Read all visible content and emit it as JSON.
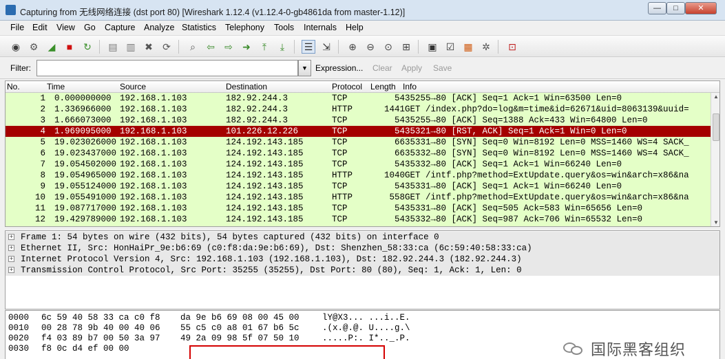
{
  "window": {
    "title": "Capturing from 无线网络连接 (dst port 80)   [Wireshark 1.12.4  (v1.12.4-0-gb4861da from master-1.12)]",
    "min_icon": "minimize-icon",
    "max_icon": "maximize-icon",
    "close_icon": "close-icon",
    "min_glyph": "—",
    "max_glyph": "□",
    "close_glyph": "✕"
  },
  "menu": [
    {
      "label": "File"
    },
    {
      "label": "Edit"
    },
    {
      "label": "View"
    },
    {
      "label": "Go"
    },
    {
      "label": "Capture"
    },
    {
      "label": "Analyze"
    },
    {
      "label": "Statistics"
    },
    {
      "label": "Telephony"
    },
    {
      "label": "Tools"
    },
    {
      "label": "Internals"
    },
    {
      "label": "Help"
    }
  ],
  "toolbar": [
    {
      "icon": "interfaces-icon",
      "glyph": "◉",
      "color": "#3c3c3c"
    },
    {
      "icon": "options-icon",
      "glyph": "⚙",
      "color": "#555555"
    },
    {
      "icon": "start-capture-icon",
      "glyph": "◢",
      "color": "#3a8f2a"
    },
    {
      "icon": "stop-capture-icon",
      "glyph": "■",
      "color": "#d01010"
    },
    {
      "icon": "restart-capture-icon",
      "glyph": "↻",
      "color": "#3a8f2a"
    },
    {
      "icon": "open-file-icon",
      "glyph": "▤",
      "color": "#7a7a7a"
    },
    {
      "icon": "save-file-icon",
      "glyph": "▥",
      "color": "#7a7a7a"
    },
    {
      "icon": "close-file-icon",
      "glyph": "✖",
      "color": "#555555"
    },
    {
      "icon": "reload-icon",
      "glyph": "⟳",
      "color": "#555555"
    },
    {
      "icon": "find-packet-icon",
      "glyph": "⌕",
      "color": "#555555"
    },
    {
      "icon": "go-back-icon",
      "glyph": "⇦",
      "color": "#3c8c2c"
    },
    {
      "icon": "go-forward-icon",
      "glyph": "⇨",
      "color": "#3c8c2c"
    },
    {
      "icon": "go-to-packet-icon",
      "glyph": "➜",
      "color": "#3c8c2c"
    },
    {
      "icon": "go-first-icon",
      "glyph": "⤒",
      "color": "#3c8c2c"
    },
    {
      "icon": "go-last-icon",
      "glyph": "⤓",
      "color": "#3c8c2c"
    },
    {
      "icon": "colorize-icon",
      "glyph": "☰",
      "color": "#333333"
    },
    {
      "icon": "auto-scroll-icon",
      "glyph": "⇲",
      "color": "#333333"
    },
    {
      "icon": "zoom-in-icon",
      "glyph": "⊕",
      "color": "#444444"
    },
    {
      "icon": "zoom-out-icon",
      "glyph": "⊖",
      "color": "#444444"
    },
    {
      "icon": "zoom-normal-icon",
      "glyph": "⊙",
      "color": "#444444"
    },
    {
      "icon": "resize-columns-icon",
      "glyph": "⊞",
      "color": "#444444"
    },
    {
      "icon": "capture-filters-icon",
      "glyph": "▣",
      "color": "#333333"
    },
    {
      "icon": "display-filters-icon",
      "glyph": "☑",
      "color": "#333333"
    },
    {
      "icon": "coloring-rules-icon",
      "glyph": "▦",
      "color": "#d05a10"
    },
    {
      "icon": "preferences-icon",
      "glyph": "✲",
      "color": "#555555"
    },
    {
      "icon": "help-icon",
      "glyph": "⊡",
      "color": "#c02020"
    }
  ],
  "filter": {
    "label": "Filter:",
    "value": "",
    "dropdown_glyph": "▼",
    "expression_label": "Expression...",
    "clear_label": "Clear",
    "apply_label": "Apply",
    "save_label": "Save"
  },
  "packet_list": {
    "columns": [
      "No.",
      "Time",
      "Source",
      "Destination",
      "Protocol",
      "Length",
      "Info"
    ],
    "rows": [
      {
        "no": "1",
        "time": "0.000000000",
        "src": "192.168.1.103",
        "dst": "182.92.244.3",
        "proto": "TCP",
        "len": "54",
        "info": "35255→80 [ACK] Seq=1 Ack=1 Win=63500 Len=0"
      },
      {
        "no": "2",
        "time": "1.336966000",
        "src": "192.168.1.103",
        "dst": "182.92.244.3",
        "proto": "HTTP",
        "len": "1441",
        "info": "GET /index.php?do=log&m=time&id=62671&uid=8063139&uuid="
      },
      {
        "no": "3",
        "time": "1.666073000",
        "src": "192.168.1.103",
        "dst": "182.92.244.3",
        "proto": "TCP",
        "len": "54",
        "info": "35255→80 [ACK] Seq=1388 Ack=433 Win=64800 Len=0"
      },
      {
        "no": "4",
        "time": "1.969095000",
        "src": "192.168.1.103",
        "dst": "101.226.12.226",
        "proto": "TCP",
        "len": "54",
        "info": "35321→80 [RST, ACK] Seq=1 Ack=1 Win=0 Len=0"
      },
      {
        "no": "5",
        "time": "19.023026000",
        "src": "192.168.1.103",
        "dst": "124.192.143.185",
        "proto": "TCP",
        "len": "66",
        "info": "35331→80 [SYN] Seq=0 Win=8192 Len=0 MSS=1460 WS=4 SACK_"
      },
      {
        "no": "6",
        "time": "19.023437000",
        "src": "192.168.1.103",
        "dst": "124.192.143.185",
        "proto": "TCP",
        "len": "66",
        "info": "35332→80 [SYN] Seq=0 Win=8192 Len=0 MSS=1460 WS=4 SACK_"
      },
      {
        "no": "7",
        "time": "19.054502000",
        "src": "192.168.1.103",
        "dst": "124.192.143.185",
        "proto": "TCP",
        "len": "54",
        "info": "35332→80 [ACK] Seq=1 Ack=1 Win=66240 Len=0"
      },
      {
        "no": "8",
        "time": "19.054965000",
        "src": "192.168.1.103",
        "dst": "124.192.143.185",
        "proto": "HTTP",
        "len": "1040",
        "info": "GET /intf.php?method=ExtUpdate.query&os=win&arch=x86&na"
      },
      {
        "no": "9",
        "time": "19.055124000",
        "src": "192.168.1.103",
        "dst": "124.192.143.185",
        "proto": "TCP",
        "len": "54",
        "info": "35331→80 [ACK] Seq=1 Ack=1 Win=66240 Len=0"
      },
      {
        "no": "10",
        "time": "19.055491000",
        "src": "192.168.1.103",
        "dst": "124.192.143.185",
        "proto": "HTTP",
        "len": "558",
        "info": "GET /intf.php?method=ExtUpdate.query&os=win&arch=x86&na"
      },
      {
        "no": "11",
        "time": "19.087717000",
        "src": "192.168.1.103",
        "dst": "124.192.143.185",
        "proto": "TCP",
        "len": "54",
        "info": "35331→80 [ACK] Seq=505 Ack=583 Win=65656 Len=0"
      },
      {
        "no": "12",
        "time": "19.429789000",
        "src": "192.168.1.103",
        "dst": "124.192.143.185",
        "proto": "TCP",
        "len": "54",
        "info": "35332→80 [ACK] Seq=987 Ack=706 Win=65532 Len=0"
      }
    ],
    "selected_row": "4",
    "row_color": "#e4ffc7",
    "selected_color": "#a40000",
    "scroll_up_glyph": "▲",
    "scroll_down_glyph": "▼"
  },
  "details": [
    {
      "expander": "+",
      "text": "Frame 1: 54 bytes on wire (432 bits), 54 bytes captured (432 bits) on interface 0"
    },
    {
      "expander": "+",
      "text": "Ethernet II, Src: HonHaiPr_9e:b6:69 (c0:f8:da:9e:b6:69), Dst: Shenzhen_58:33:ca (6c:59:40:58:33:ca)"
    },
    {
      "expander": "+",
      "text": "Internet Protocol Version 4, Src: 192.168.1.103 (192.168.1.103), Dst: 182.92.244.3 (182.92.244.3)"
    },
    {
      "expander": "+",
      "text": "Transmission Control Protocol, Src Port: 35255 (35255), Dst Port: 80 (80), Seq: 1, Ack: 1, Len: 0"
    }
  ],
  "bytes": [
    {
      "offset": "0000",
      "hex1": "6c 59 40 58 33 ca c0 f8",
      "hex2": "da 9e b6 69 08 00 45 00",
      "ascii": "lY@X3... ...i..E."
    },
    {
      "offset": "0010",
      "hex1": "00 28 78 9b 40 00 40 06",
      "hex2": "55 c5 c0 a8 01 67 b6 5c",
      "ascii": ".(x.@.@. U....g.\\"
    },
    {
      "offset": "0020",
      "hex1": "f4 03 89 b7 00 50 3a 97",
      "hex2": "49 2a 09 98 5f 07 50 10",
      "ascii": ".....P:. I*.._.P."
    },
    {
      "offset": "0030",
      "hex1": "f8 0c d4 ef 00 00",
      "hex2": "",
      "ascii": ""
    }
  ],
  "watermark": {
    "icon": "wechat-icon",
    "text": "国际黑客组织"
  }
}
